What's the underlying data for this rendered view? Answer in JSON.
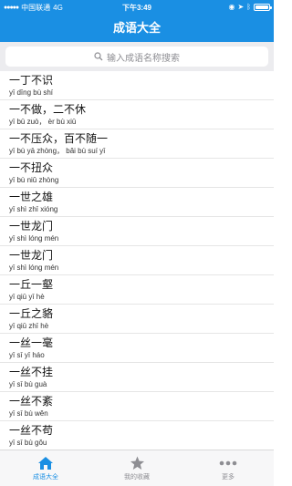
{
  "status": {
    "carrier": "中国联通",
    "network": "4G",
    "time": "下午3:49"
  },
  "header": {
    "title": "成语大全"
  },
  "search": {
    "placeholder": "输入成语名称搜索"
  },
  "idioms": [
    {
      "word": "一丁不识",
      "pinyin": "yī dīng bù shí"
    },
    {
      "word": "一不做，二不休",
      "pinyin": "yī bū zuò， èr bù xiū"
    },
    {
      "word": "一不压众，百不随一",
      "pinyin": "yī bù yā zhòng， bǎi bù suí yī"
    },
    {
      "word": "一不扭众",
      "pinyin": "yī bù niǔ zhòng"
    },
    {
      "word": "一世之雄",
      "pinyin": "yī shì zhī xióng"
    },
    {
      "word": "一世龙门",
      "pinyin": "yī shì lóng mén"
    },
    {
      "word": "一世龙门",
      "pinyin": "yī shì lóng mén"
    },
    {
      "word": "一丘一壑",
      "pinyin": "yī qiū yī hè"
    },
    {
      "word": "一丘之貉",
      "pinyin": "yī qiū zhī hè"
    },
    {
      "word": "一丝一毫",
      "pinyin": "yī sī yī háo"
    },
    {
      "word": "一丝不挂",
      "pinyin": "yī sī bù guà"
    },
    {
      "word": "一丝不紊",
      "pinyin": "yī sī bù wěn"
    },
    {
      "word": "一丝不苟",
      "pinyin": "yī sī bù gǒu"
    }
  ],
  "tabs": [
    {
      "label": "成语大全",
      "icon": "home-icon",
      "active": true
    },
    {
      "label": "我的收藏",
      "icon": "star-icon",
      "active": false
    },
    {
      "label": "更多",
      "icon": "more-icon",
      "active": false
    }
  ],
  "colors": {
    "accent": "#1a8fe3",
    "inactive": "#8e8e93"
  }
}
